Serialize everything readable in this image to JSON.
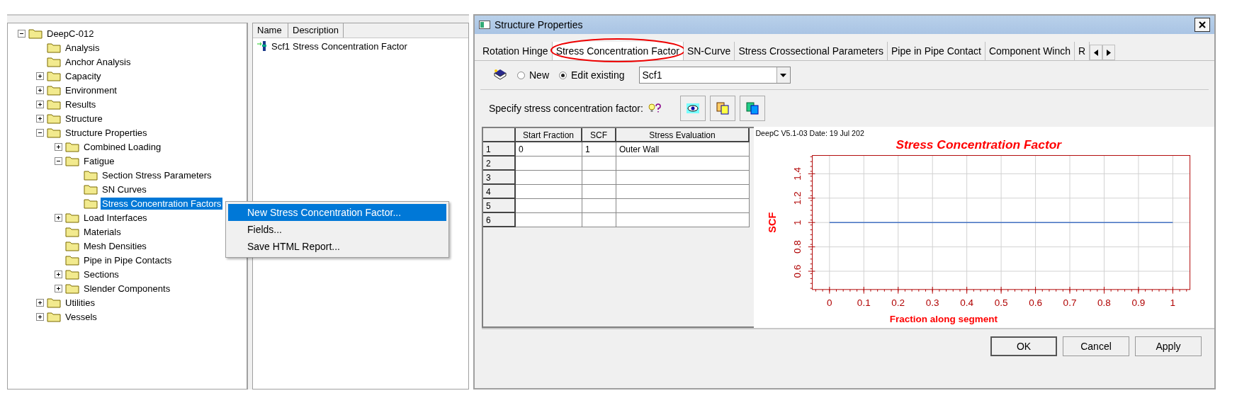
{
  "explorer": {
    "tree": [
      {
        "label": "DeepC-012",
        "expanded": true,
        "selected": false,
        "children": [
          {
            "label": "Analysis",
            "selected": false
          },
          {
            "label": "Anchor Analysis",
            "selected": false
          },
          {
            "label": "Capacity",
            "expanded": false,
            "selected": false
          },
          {
            "label": "Environment",
            "expanded": false,
            "selected": false
          },
          {
            "label": "Results",
            "expanded": false,
            "selected": false
          },
          {
            "label": "Structure",
            "expanded": false,
            "selected": false
          },
          {
            "label": "Structure Properties",
            "expanded": true,
            "selected": false,
            "children": [
              {
                "label": "Combined Loading",
                "expanded": false,
                "selected": false
              },
              {
                "label": "Fatigue",
                "expanded": true,
                "selected": false,
                "children": [
                  {
                    "label": "Section Stress Parameters",
                    "selected": false
                  },
                  {
                    "label": "SN Curves",
                    "selected": false
                  },
                  {
                    "label": "Stress Concentration Factors",
                    "selected": true
                  }
                ]
              },
              {
                "label": "Load Interfaces",
                "expanded": false,
                "selected": false
              },
              {
                "label": "Materials",
                "selected": false
              },
              {
                "label": "Mesh Densities",
                "selected": false
              },
              {
                "label": "Pipe in Pipe Contacts",
                "selected": false
              },
              {
                "label": "Sections",
                "expanded": false,
                "selected": false
              },
              {
                "label": "Slender Components",
                "expanded": false,
                "selected": false
              }
            ]
          },
          {
            "label": "Utilities",
            "expanded": false,
            "selected": false
          },
          {
            "label": "Vessels",
            "expanded": false,
            "selected": false
          }
        ]
      }
    ],
    "list": {
      "columns": [
        "Name",
        "Description"
      ],
      "rows": [
        {
          "name": "Scf1",
          "description": "Stress Concentration Factor"
        }
      ]
    },
    "context_menu": [
      {
        "label": "New Stress Concentration Factor...",
        "selected": true
      },
      {
        "label": "Fields...",
        "selected": false
      },
      {
        "label": "Save HTML Report...",
        "selected": false
      }
    ]
  },
  "dialog": {
    "title": "Structure Properties",
    "tabs": [
      {
        "label": "Rotation Hinge",
        "selected": false,
        "circled": false
      },
      {
        "label": "Stress Concentration Factor",
        "selected": true,
        "circled": true
      },
      {
        "label": "SN-Curve",
        "selected": false,
        "circled": false
      },
      {
        "label": "Stress Crossectional Parameters",
        "selected": false,
        "circled": false
      },
      {
        "label": "Pipe in Pipe Contact",
        "selected": false,
        "circled": false
      },
      {
        "label": "Component Winch",
        "selected": false,
        "circled": false
      },
      {
        "label": "R",
        "selected": false,
        "circled": false
      }
    ],
    "mode": [
      {
        "label": "New",
        "selected": false
      },
      {
        "label": "Edit existing",
        "selected": true
      }
    ],
    "existing": {
      "value": "Scf1"
    },
    "specify_label": "Specify stress concentration factor:",
    "table": {
      "columns": [
        "Start Fraction",
        "SCF",
        "Stress Evaluation"
      ],
      "rows": [
        {
          "index": "1",
          "cells": [
            "0",
            "1",
            "Outer Wall"
          ]
        },
        {
          "index": "2"
        },
        {
          "index": "3"
        },
        {
          "index": "4"
        },
        {
          "index": "5"
        },
        {
          "index": "6"
        }
      ]
    },
    "chart": {
      "stamp": "DeepC V5.1-03 Date: 19 Jul 202",
      "chart_data": {
        "type": "line",
        "title": "Stress Concentration Factor",
        "xlabel": "Fraction along segment",
        "ylabel": "SCF",
        "x": [
          0,
          1
        ],
        "series": [
          {
            "color": "#4472c4",
            "values": [
              1,
              1
            ]
          }
        ],
        "xlim": [
          -0.05,
          1.05
        ],
        "ylim": [
          0.45,
          1.55
        ],
        "xticks": [
          {
            "value": 0,
            "label": "0"
          },
          {
            "value": 0.1,
            "label": "0.1"
          },
          {
            "value": 0.2,
            "label": "0.2"
          },
          {
            "value": 0.3,
            "label": "0.3"
          },
          {
            "value": 0.4,
            "label": "0.4"
          },
          {
            "value": 0.5,
            "label": "0.5"
          },
          {
            "value": 0.6,
            "label": "0.6"
          },
          {
            "value": 0.7,
            "label": "0.7"
          },
          {
            "value": 0.8,
            "label": "0.8"
          },
          {
            "value": 0.9,
            "label": "0.9"
          },
          {
            "value": 1,
            "label": "1"
          }
        ],
        "yticks": [
          {
            "value": 0.6,
            "label": "0.6"
          },
          {
            "value": 0.8,
            "label": "0.8"
          },
          {
            "value": 1,
            "label": "1"
          },
          {
            "value": 1.2,
            "label": "1.2"
          },
          {
            "value": 1.4,
            "label": "1.4"
          }
        ],
        "grid": true
      }
    },
    "buttons": [
      {
        "label": "OK",
        "default": true
      },
      {
        "label": "Cancel",
        "default": false
      },
      {
        "label": "Apply",
        "default": false
      }
    ]
  }
}
